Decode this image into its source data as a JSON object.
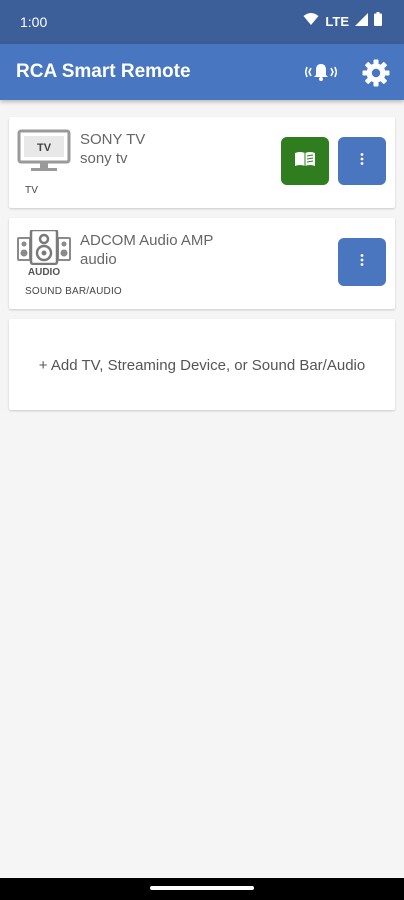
{
  "status_bar": {
    "time": "1:00",
    "network": "LTE"
  },
  "app_bar": {
    "title": "RCA Smart Remote",
    "bell_icon": "vibrating-bell-icon",
    "settings_icon": "gear-icon"
  },
  "devices": [
    {
      "name": "SONY TV",
      "subname": "sony tv",
      "type": "TV",
      "icon": "tv-icon",
      "icon_label": "TV",
      "has_guide": true
    },
    {
      "name": "ADCOM Audio AMP",
      "subname": "audio",
      "type": "SOUND BAR/AUDIO",
      "icon": "speaker-icon",
      "icon_label": "AUDIO",
      "has_guide": false
    }
  ],
  "add_device": {
    "label": "+ Add TV, Streaming Device, or Sound Bar/Audio"
  },
  "colors": {
    "status_bar": "#3c5f99",
    "app_bar": "#4876c0",
    "guide_button": "#2f7d1f",
    "more_button": "#4a76c0",
    "background": "#f5f5f5"
  }
}
